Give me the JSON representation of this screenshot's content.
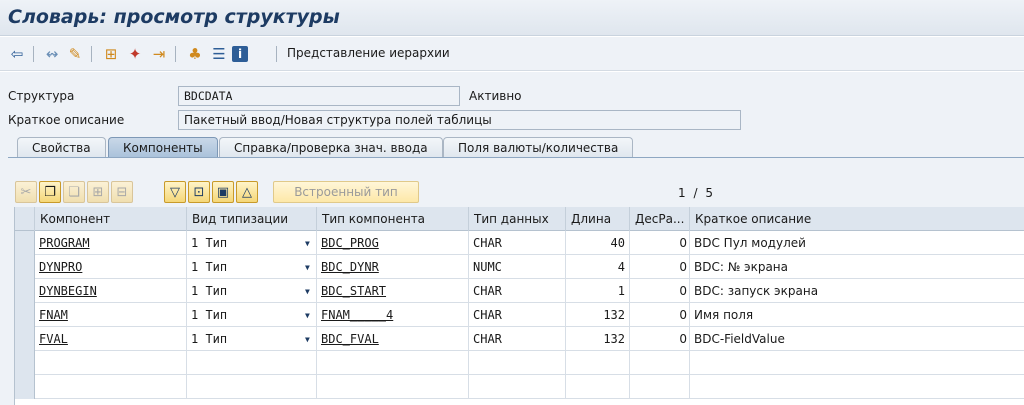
{
  "window": {
    "title": "Словарь: просмотр структуры"
  },
  "toolbar": {
    "icons": [
      "back-icon",
      "other-object-icon",
      "display-change-icon",
      "where-used-icon",
      "activate-icon",
      "object-list-icon",
      "hierarchy-icon",
      "structure-icon",
      "info-icon"
    ],
    "hierarchy_label": "Представление иерархии"
  },
  "header": {
    "structure_label": "Структура",
    "structure_value": "BDCDATA",
    "status": "Активно",
    "short_desc_label": "Краткое описание",
    "short_desc_value": "Пакетный ввод/Новая структура полей таблицы"
  },
  "tabs": [
    {
      "label": "Свойства",
      "active": false
    },
    {
      "label": "Компоненты",
      "active": true
    },
    {
      "label": "Справка/проверка знач. ввода",
      "active": false
    },
    {
      "label": "Поля валюты/количества",
      "active": false
    }
  ],
  "grid_toolbar": {
    "builtin_type_label": "Встроенный тип",
    "page_current": "1",
    "page_separator": "/",
    "page_total": "5"
  },
  "table": {
    "columns": [
      "Компонент",
      "Вид типизации",
      "Тип компонента",
      "Тип данных",
      "Длина",
      "ДесРа...",
      "Краткое описание"
    ],
    "rows": [
      {
        "component": "PROGRAM",
        "typing": "1 Тип",
        "comp_type": "BDC_PROG",
        "data_type": "CHAR",
        "length": "40",
        "decimals": "0",
        "description": "BDC Пул модулей"
      },
      {
        "component": "DYNPRO",
        "typing": "1 Тип",
        "comp_type": "BDC_DYNR",
        "data_type": "NUMC",
        "length": "4",
        "decimals": "0",
        "description": "BDC: № экрана"
      },
      {
        "component": "DYNBEGIN",
        "typing": "1 Тип",
        "comp_type": "BDC_START",
        "data_type": "CHAR",
        "length": "1",
        "decimals": "0",
        "description": "BDC: запуск экрана"
      },
      {
        "component": "FNAM",
        "typing": "1 Тип",
        "comp_type": "FNAM_____4",
        "data_type": "CHAR",
        "length": "132",
        "decimals": "0",
        "description": "Имя поля"
      },
      {
        "component": "FVAL",
        "typing": "1 Тип",
        "comp_type": "BDC_FVAL",
        "data_type": "CHAR",
        "length": "132",
        "decimals": "0",
        "description": "BDC-FieldValue"
      }
    ]
  },
  "colors": {
    "title": "#1d3b63",
    "background": "#eef2f7",
    "active_tab": "#a9c1da",
    "grid_header": "#dde5ee"
  }
}
